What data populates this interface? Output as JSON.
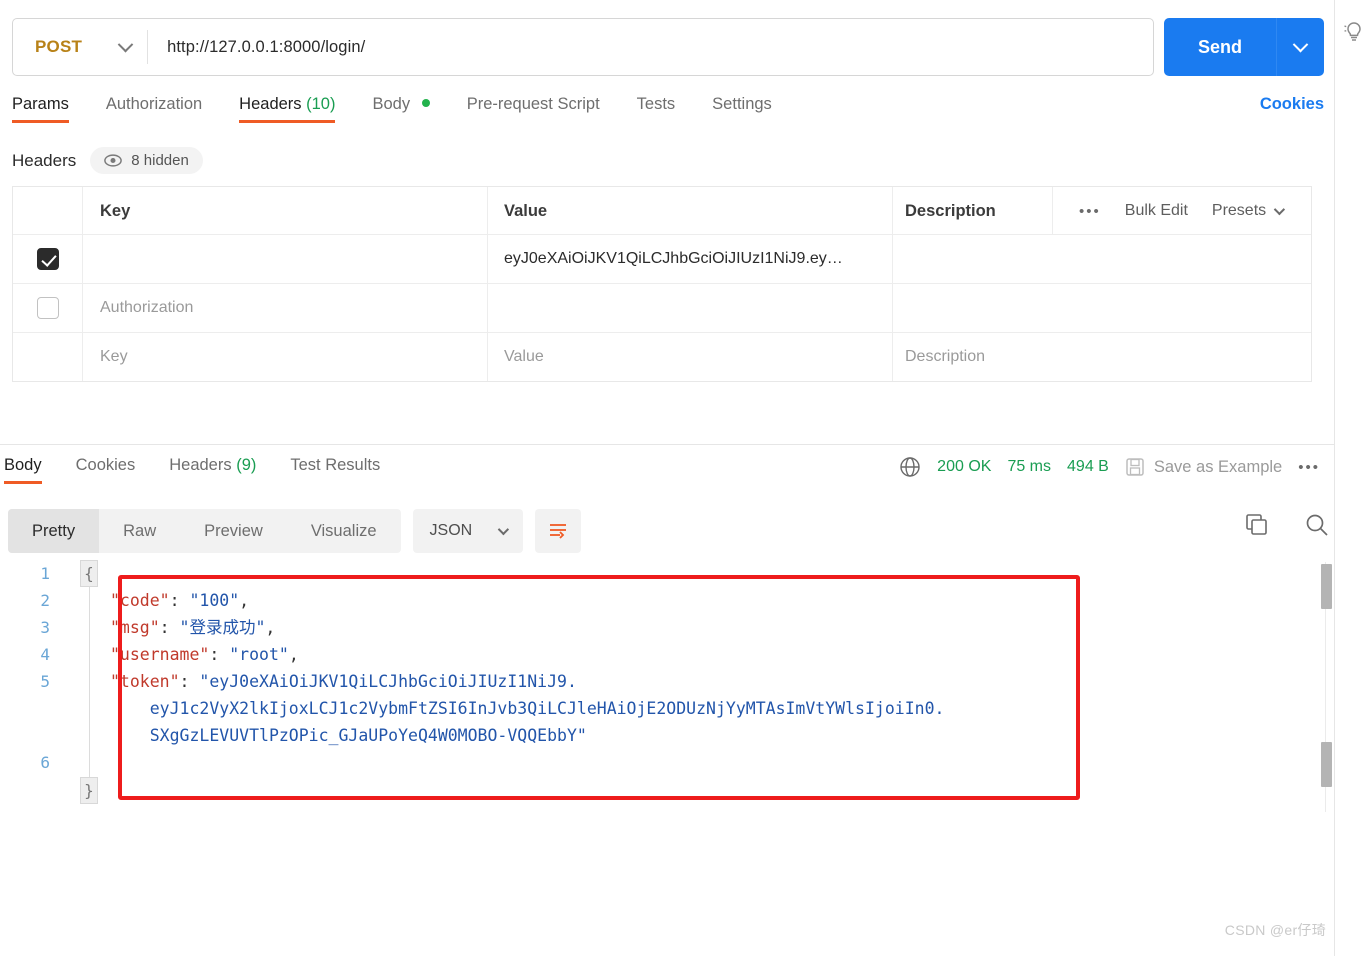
{
  "request": {
    "method": "POST",
    "url": "http://127.0.0.1:8000/login/",
    "send_label": "Send",
    "tabs": [
      {
        "label": "Params",
        "count": "",
        "dot": false,
        "active": false
      },
      {
        "label": "Authorization",
        "count": "",
        "dot": false,
        "active": false
      },
      {
        "label": "Headers",
        "count": "(10)",
        "dot": false,
        "active": true
      },
      {
        "label": "Body",
        "count": "",
        "dot": true,
        "active": false
      },
      {
        "label": "Pre-request Script",
        "count": "",
        "dot": false,
        "active": false
      },
      {
        "label": "Tests",
        "count": "",
        "dot": false,
        "active": false
      },
      {
        "label": "Settings",
        "count": "",
        "dot": false,
        "active": false
      }
    ],
    "cookies_link": "Cookies"
  },
  "headers_panel": {
    "title": "Headers",
    "hidden_badge": "8 hidden",
    "columns": [
      "Key",
      "Value",
      "Description"
    ],
    "actions": {
      "more": "•••",
      "bulk_edit": "Bulk Edit",
      "presets": "Presets"
    },
    "rows": [
      {
        "checked": true,
        "key": "",
        "key_placeholder": "",
        "value": "eyJ0eXAiOiJKV1QiLCJhbGciOiJIUzI1NiJ9.ey…",
        "value_placeholder": "",
        "description": "",
        "description_placeholder": ""
      },
      {
        "checked": false,
        "key": "",
        "key_placeholder": "Authorization",
        "value": "",
        "value_placeholder": "",
        "description": "",
        "description_placeholder": ""
      },
      {
        "checked": null,
        "key": "",
        "key_placeholder": "Key",
        "value": "",
        "value_placeholder": "Value",
        "description": "",
        "description_placeholder": "Description"
      }
    ]
  },
  "response": {
    "tabs": [
      {
        "label": "Body",
        "count": "",
        "active": true
      },
      {
        "label": "Cookies",
        "count": "",
        "active": false
      },
      {
        "label": "Headers",
        "count": "(9)",
        "active": false
      },
      {
        "label": "Test Results",
        "count": "",
        "active": false
      }
    ],
    "status": "200 OK",
    "time": "75 ms",
    "size": "494 B",
    "save_as_example": "Save as Example",
    "more": "•••",
    "view_modes": [
      {
        "label": "Pretty",
        "active": true
      },
      {
        "label": "Raw",
        "active": false
      },
      {
        "label": "Preview",
        "active": false
      },
      {
        "label": "Visualize",
        "active": false
      }
    ],
    "format": "JSON",
    "line_numbers": [
      "1",
      "2",
      "3",
      "4",
      "5",
      "6"
    ],
    "open_brace": "{",
    "close_brace": "}",
    "body_lines": [
      [
        {
          "t": "\"code\"",
          "c": "k"
        },
        {
          "t": ": ",
          "c": "p"
        },
        {
          "t": "\"100\"",
          "c": "s"
        },
        {
          "t": ",",
          "c": "p"
        }
      ],
      [
        {
          "t": "\"msg\"",
          "c": "k"
        },
        {
          "t": ": ",
          "c": "p"
        },
        {
          "t": "\"登录成功\"",
          "c": "s"
        },
        {
          "t": ",",
          "c": "p"
        }
      ],
      [
        {
          "t": "\"username\"",
          "c": "k"
        },
        {
          "t": ": ",
          "c": "p"
        },
        {
          "t": "\"root\"",
          "c": "s"
        },
        {
          "t": ",",
          "c": "p"
        }
      ],
      [
        {
          "t": "\"token\"",
          "c": "k"
        },
        {
          "t": ": ",
          "c": "p"
        },
        {
          "t": "\"eyJ0eXAiOiJKV1QiLCJhbGciOiJIUzI1NiJ9.",
          "c": "s"
        }
      ],
      [
        {
          "t": "    eyJ1c2VyX2lkIjoxLCJ1c2VybmFtZSI6InJvb3QiLCJleHAiOjE2ODUzNjYyMTAsImVtYWlsIjoiIn0.",
          "c": "s"
        }
      ],
      [
        {
          "t": "    SXgGzLEVUVTlPzOPic_GJaUPoYeQ4W0MOBO-VQQEbbY\"",
          "c": "s"
        }
      ]
    ],
    "json_values": {
      "code": "100",
      "msg": "登录成功",
      "username": "root",
      "token": "eyJ0eXAiOiJKV1QiLCJhbGciOiJIUzI1NiJ9.eyJ1c2VyX2lkIjoxLCJ1c2VybmFtZSI6InJvb3QiLCJleHAiOjE2ODUzNjYyMTAsImVtYWlsIjoiIn0.SXgGzLEVUVTlPzOPic_GJaUPoYeQ4W0MOBO-VQQEbbY"
    }
  },
  "watermark": "CSDN @er仔琦",
  "colors": {
    "accent_orange": "#ef5b25",
    "send_blue": "#1a7bf0",
    "success_green": "#1a9d52",
    "method_amber": "#b88218",
    "highlight_red": "#ee1c1c",
    "json_key": "#c0392b",
    "json_string": "#2255aa"
  }
}
